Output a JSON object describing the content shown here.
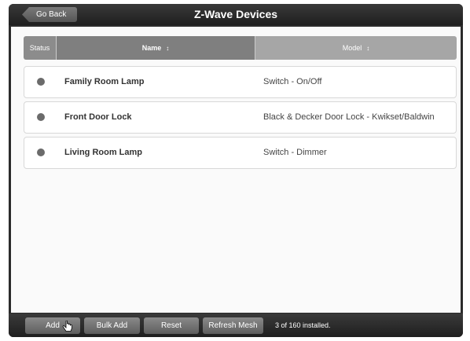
{
  "header": {
    "back_label": "Go Back",
    "title": "Z-Wave Devices"
  },
  "table": {
    "columns": {
      "status": "Status",
      "name": "Name",
      "model": "Model"
    },
    "sort_arrow": "↕",
    "rows": [
      {
        "name": "Family Room Lamp",
        "model": "Switch - On/Off"
      },
      {
        "name": "Front Door Lock",
        "model": "Black & Decker Door Lock - Kwikset/Baldwin"
      },
      {
        "name": "Living Room Lamp",
        "model": "Switch - Dimmer"
      }
    ]
  },
  "toolbar": {
    "add_label": "Add",
    "bulk_add_label": "Bulk Add",
    "reset_label": "Reset",
    "refresh_label": "Refresh Mesh",
    "status": "3 of 160 installed."
  }
}
